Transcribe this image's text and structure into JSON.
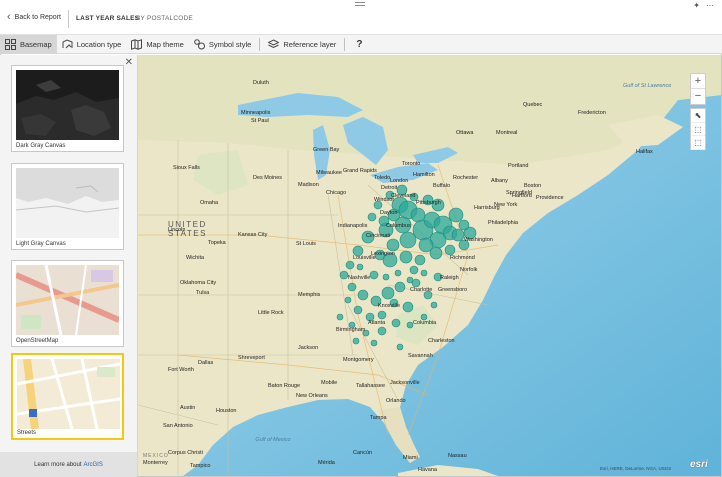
{
  "header": {
    "back_label": "Back to Report",
    "title": "LAST YEAR SALES",
    "subtitle": "BY POSTALCODE"
  },
  "toolbar": {
    "items": [
      {
        "label": "Basemap",
        "icon": "basemap-icon"
      },
      {
        "label": "Location type",
        "icon": "location-type-icon"
      },
      {
        "label": "Map theme",
        "icon": "map-theme-icon"
      },
      {
        "label": "Symbol style",
        "icon": "symbol-style-icon"
      },
      {
        "label": "Reference layer",
        "icon": "reference-layer-icon"
      }
    ],
    "help": "?",
    "active_color": "#d6d6d6"
  },
  "panel": {
    "close": "✕",
    "basemaps": [
      {
        "label": "Dark Gray Canvas"
      },
      {
        "label": "Light Gray Canvas"
      },
      {
        "label": "OpenStreetMap"
      },
      {
        "label": "Streets",
        "selected": true
      }
    ],
    "footer_text": "Learn more about",
    "footer_link": "ArcGIS",
    "selected_color": "#f2c811"
  },
  "map": {
    "country": [
      "UNITED",
      "STATES"
    ],
    "oceans": [
      {
        "name": "Gulf of St Lawrence"
      },
      {
        "name": "Gulf of Mexico"
      }
    ],
    "cities": [
      "Minneapolis",
      "St Paul",
      "Milwaukee",
      "Chicago",
      "Detroit",
      "Toronto",
      "Ottawa",
      "Montreal",
      "Quebec",
      "Albany",
      "Boston",
      "New York",
      "Philadelphia",
      "Washington",
      "Pittsburgh",
      "Cleveland",
      "Columbus",
      "Indianapolis",
      "Cincinnati",
      "Louisville",
      "St Louis",
      "Kansas City",
      "Omaha",
      "Des Moines",
      "Oklahoma City",
      "Tulsa",
      "Memphis",
      "Nashville",
      "Atlanta",
      "Birmingham",
      "Charlotte",
      "Raleigh",
      "Richmond",
      "Norfolk",
      "Jacksonville",
      "Tampa",
      "Orlando",
      "Miami",
      "New Orleans",
      "Houston",
      "Dallas",
      "Fort Worth",
      "Austin",
      "San Antonio",
      "Havana",
      "Nassau",
      "Halifax",
      "Portland",
      "Fredericton",
      "Buffalo",
      "Rochester",
      "Hamilton",
      "London",
      "Windsor",
      "Grand Rapids",
      "Green Bay",
      "Madison",
      "Duluth",
      "Sioux Falls",
      "Little Rock",
      "Jackson",
      "Montgomery",
      "Mobile",
      "Tallahassee",
      "Savannah",
      "Charleston",
      "Columbia",
      "Greensboro",
      "Knoxville",
      "Lexington",
      "Dayton",
      "Toledo",
      "Harrisburg",
      "Hartford",
      "Providence",
      "Springfield",
      "Wichita",
      "Lincoln",
      "Topeka",
      "Shreveport",
      "Baton Rouge",
      "Corpus Christi",
      "Monterrey",
      "Tampico",
      "Mérida",
      "Cancún",
      "MEXICO"
    ],
    "attribution": "Esri, HERE, DeLorme, NGA, USGS",
    "logo": "esri",
    "bubble_color": "#2aa89a"
  }
}
